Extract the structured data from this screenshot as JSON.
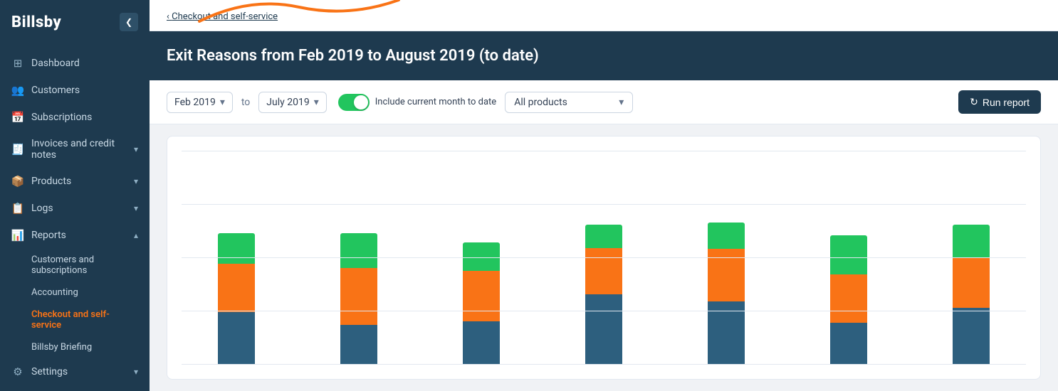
{
  "sidebar": {
    "logo": "Billsby",
    "collapse_icon": "❮",
    "items": [
      {
        "id": "dashboard",
        "label": "Dashboard",
        "icon": "dashboard",
        "has_chevron": false
      },
      {
        "id": "customers",
        "label": "Customers",
        "icon": "customers",
        "has_chevron": false
      },
      {
        "id": "subscriptions",
        "label": "Subscriptions",
        "icon": "subscriptions",
        "has_chevron": false
      },
      {
        "id": "invoices",
        "label": "Invoices and credit notes",
        "icon": "invoices",
        "has_chevron": true
      },
      {
        "id": "products",
        "label": "Products",
        "icon": "products",
        "has_chevron": true
      },
      {
        "id": "logs",
        "label": "Logs",
        "icon": "logs",
        "has_chevron": true
      },
      {
        "id": "reports",
        "label": "Reports",
        "icon": "reports",
        "has_chevron": true,
        "expanded": true
      },
      {
        "id": "settings",
        "label": "Settings",
        "icon": "settings",
        "has_chevron": true
      }
    ],
    "sub_items": [
      {
        "id": "customers-subs",
        "label": "Customers and subscriptions",
        "active": false
      },
      {
        "id": "accounting",
        "label": "Accounting",
        "active": false
      },
      {
        "id": "checkout",
        "label": "Checkout and self-service",
        "active": true
      },
      {
        "id": "briefing",
        "label": "Billsby Briefing",
        "active": false
      }
    ]
  },
  "breadcrumb": {
    "link_text": "Checkout and self-service"
  },
  "page": {
    "title": "Exit Reasons from Feb 2019 to August 2019 (to date)"
  },
  "controls": {
    "from_date": "Feb 2019",
    "to_label": "to",
    "to_date": "July 2019",
    "toggle_label": "Include current month to date",
    "toggle_on": true,
    "product_select": "All products",
    "run_button": "Run report",
    "run_icon": "↻"
  },
  "chart": {
    "bars": [
      {
        "blue": 120,
        "orange": 110,
        "green": 70
      },
      {
        "blue": 90,
        "orange": 130,
        "green": 80
      },
      {
        "blue": 100,
        "orange": 115,
        "green": 65
      },
      {
        "blue": 160,
        "orange": 105,
        "green": 55
      },
      {
        "blue": 145,
        "orange": 120,
        "green": 60
      },
      {
        "blue": 95,
        "orange": 110,
        "green": 90
      },
      {
        "blue": 130,
        "orange": 115,
        "green": 75
      }
    ],
    "grid_lines": 5
  }
}
